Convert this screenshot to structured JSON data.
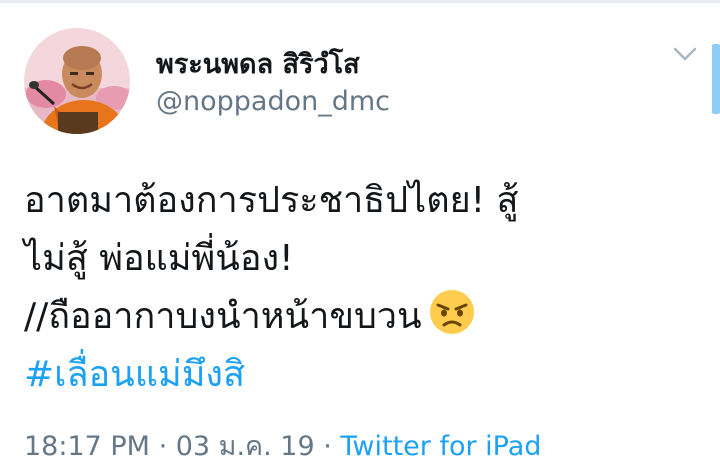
{
  "tweet": {
    "author": {
      "display_name": "พระนพดล สิริวํโส",
      "handle": "@noppadon_dmc"
    },
    "text_lines": [
      "อาตมาต้องการประชาธิปไตย! สู้",
      "ไม่สู้ พ่อแม่พี่น้อง!",
      "//ถืออากาบงนำหน้าขบวน"
    ],
    "emoji": "angry-face",
    "hashtag": "#เลื่อนแม่มึงสิ",
    "meta": {
      "time": "18:17 PM",
      "sep1": " · ",
      "date": "03 ม.ค. 19",
      "sep2": " · ",
      "source": "Twitter for iPad"
    }
  },
  "colors": {
    "link": "#1da1f2",
    "text": "#14171a",
    "muted": "#657786",
    "emoji_face": "#ffcc4d"
  }
}
